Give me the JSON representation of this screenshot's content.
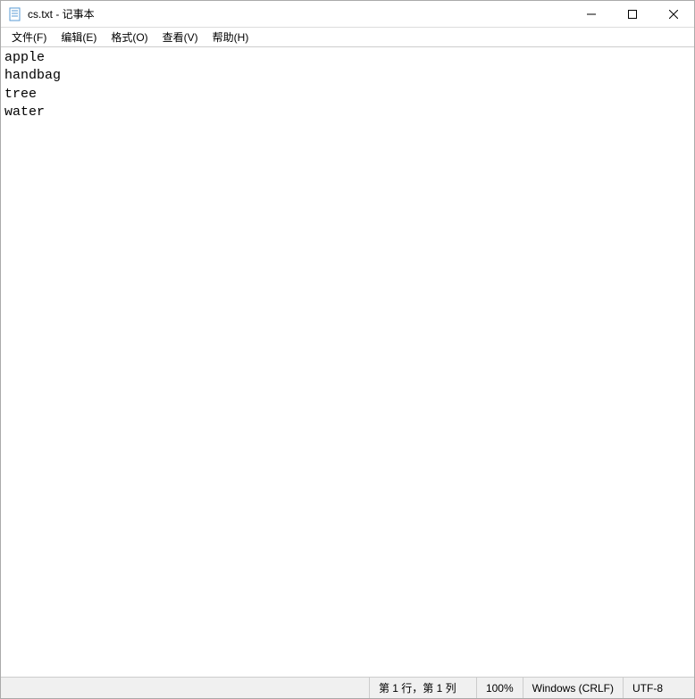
{
  "window": {
    "title": "cs.txt - 记事本"
  },
  "menu": {
    "file": "文件(F)",
    "edit": "编辑(E)",
    "format": "格式(O)",
    "view": "查看(V)",
    "help": "帮助(H)"
  },
  "content": {
    "lines": [
      "apple",
      "handbag",
      "tree",
      "water"
    ]
  },
  "status": {
    "position": "第 1 行，第 1 列",
    "zoom": "100%",
    "eol": "Windows (CRLF)",
    "encoding": "UTF-8"
  }
}
